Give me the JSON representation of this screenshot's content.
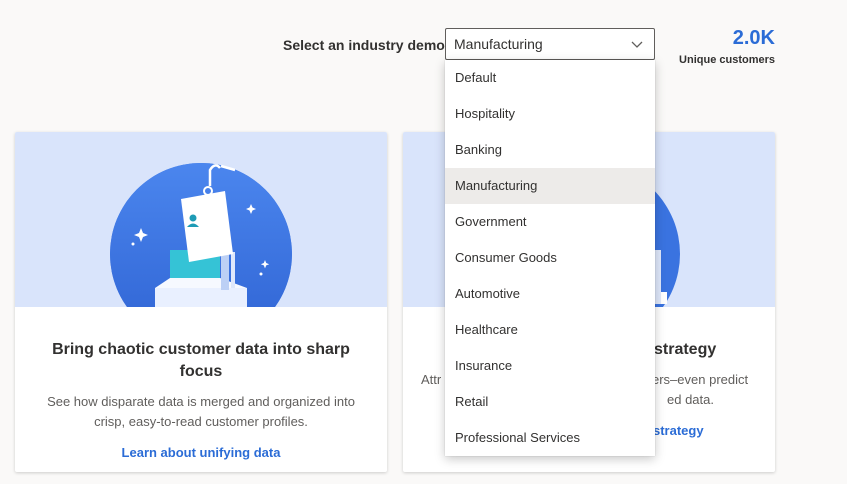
{
  "header": {
    "label": "Select an industry demo",
    "selected": "Manufacturing"
  },
  "metric": {
    "value": "2.0K",
    "label": "Unique customers"
  },
  "dropdown": {
    "options": [
      "Default",
      "Hospitality",
      "Banking",
      "Manufacturing",
      "Government",
      "Consumer Goods",
      "Automotive",
      "Healthcare",
      "Insurance",
      "Retail",
      "Professional Services"
    ],
    "selected_index": 3
  },
  "cards": [
    {
      "title": "Bring chaotic customer data into sharp focus",
      "description": "See how disparate data is merged and organized into crisp, easy-to-read customer profiles.",
      "link": "Learn about unifying data"
    },
    {
      "title": "strategy",
      "description_line1": "Attr",
      "description_line1_end": "ers–even predict",
      "description_line2_end": "ed data.",
      "link": "strategy"
    }
  ],
  "colors": {
    "accent": "#2b6cd6",
    "hero_bg": "#d9e4fb",
    "selected_option_bg": "#edebe9"
  },
  "icons": [
    "chevron-down-icon",
    "hero-illustration"
  ]
}
